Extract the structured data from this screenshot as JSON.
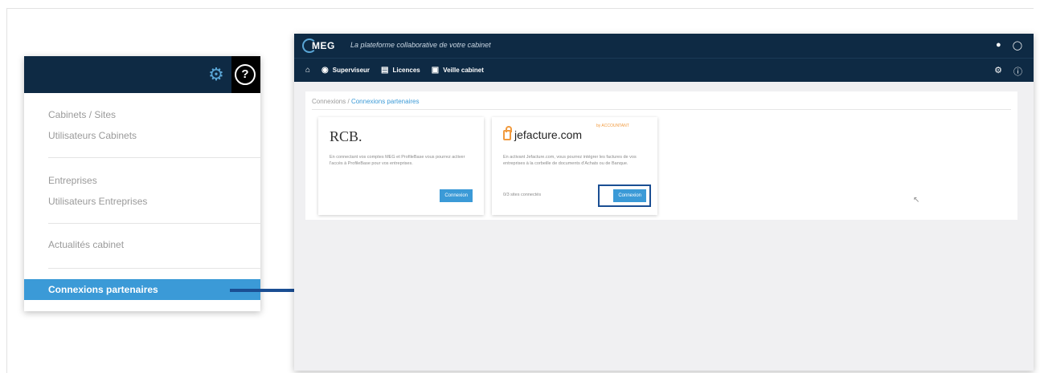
{
  "menu": {
    "items": [
      {
        "label": "Cabinets / Sites"
      },
      {
        "label": "Utilisateurs Cabinets"
      },
      {
        "label": "Entreprises"
      },
      {
        "label": "Utilisateurs Entreprises"
      },
      {
        "label": "Actualités cabinet"
      }
    ],
    "active_item": "Connexions partenaires",
    "icons": {
      "settings": "gear-icon",
      "help": "help-circle-icon"
    },
    "accent_color": "#3b9ad7",
    "header_color": "#0e2a44"
  },
  "app": {
    "logo_text": "MEG",
    "tagline": "La plateforme collaborative de votre cabinet",
    "nav": [
      {
        "icon": "home-icon",
        "label": ""
      },
      {
        "icon": "eye-icon",
        "label": "Superviseur"
      },
      {
        "icon": "document-icon",
        "label": "Licences"
      },
      {
        "icon": "binoculars-icon",
        "label": "Veille cabinet"
      }
    ],
    "breadcrumb": {
      "root": "Connexions",
      "separator": "/",
      "current": "Connexions partenaires"
    },
    "cards": [
      {
        "logo_text": "RCB.",
        "description": "En connectant vos comptes MEG et ProfileBase vous pourrez activer l'accès à ProfileBase pour vos entreprises.",
        "status": "",
        "button_label": "Connexion"
      },
      {
        "logo_text": "jefacture.com",
        "logo_tag": "by ACCOUNTANT",
        "description": "En activant Jefacture.com, vous pourrez intégrer les factures de vos entreprises à la corbeille de documents d'Achats ou de Banque.",
        "status": "0/3 sites connectés",
        "button_label": "Connexion"
      }
    ]
  }
}
